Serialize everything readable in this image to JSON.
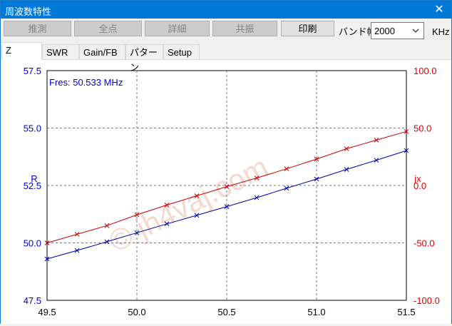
{
  "window": {
    "title": "周波数特性",
    "close_glyph": "✕"
  },
  "toolbar": {
    "buttons": [
      {
        "label": "推測",
        "enabled": false
      },
      {
        "label": "全点",
        "enabled": false
      },
      {
        "label": "詳細",
        "enabled": false
      },
      {
        "label": "共振",
        "enabled": false
      },
      {
        "label": "印刷",
        "enabled": true
      }
    ],
    "band_label": "バンド幅",
    "band_value": "2000",
    "unit": "KHz"
  },
  "tabs": [
    {
      "label": "Z",
      "active": true
    },
    {
      "label": "SWR",
      "active": false
    },
    {
      "label": "Gain/FB",
      "active": false
    },
    {
      "label": "パターン",
      "active": false
    },
    {
      "label": "Setup",
      "active": false
    }
  ],
  "chart_data": {
    "type": "line",
    "annotation": "Fres: 50.533 MHz",
    "watermark": "© jh4vaj.com",
    "xlim": [
      49.5,
      51.5
    ],
    "x_ticks": [
      "49.5",
      "50.0",
      "50.5",
      "51.0",
      "51.5"
    ],
    "y_left": {
      "label": "R",
      "lim": [
        47.5,
        57.5
      ],
      "ticks": [
        "47.5",
        "50.0",
        "52.5",
        "55.0",
        "57.5"
      ],
      "color": "#0000cc"
    },
    "y_right": {
      "label": "jx",
      "lim": [
        -100,
        100
      ],
      "ticks": [
        "-100.0",
        "-50.0",
        "0.0",
        "50.0",
        "100.0"
      ],
      "color": "#dd0000"
    },
    "grid": true,
    "series": [
      {
        "axis": "left",
        "color": "#0000aa",
        "x": [
          49.5,
          49.667,
          49.833,
          50.0,
          50.167,
          50.333,
          50.5,
          50.667,
          50.833,
          51.0,
          51.167,
          51.333,
          51.5
        ],
        "y": [
          49.3,
          49.67,
          50.05,
          50.44,
          50.83,
          51.2,
          51.58,
          51.97,
          52.38,
          52.78,
          53.2,
          53.6,
          54.02
        ]
      },
      {
        "axis": "right",
        "color": "#cc0000",
        "x": [
          49.5,
          49.667,
          49.833,
          50.0,
          50.167,
          50.333,
          50.5,
          50.667,
          50.833,
          51.0,
          51.167,
          51.333,
          51.5
        ],
        "y": [
          -50.0,
          -42.5,
          -35.0,
          -25.5,
          -17.0,
          -9.0,
          -1.0,
          6.5,
          14.5,
          23.0,
          32.0,
          39.5,
          47.0
        ]
      }
    ]
  }
}
